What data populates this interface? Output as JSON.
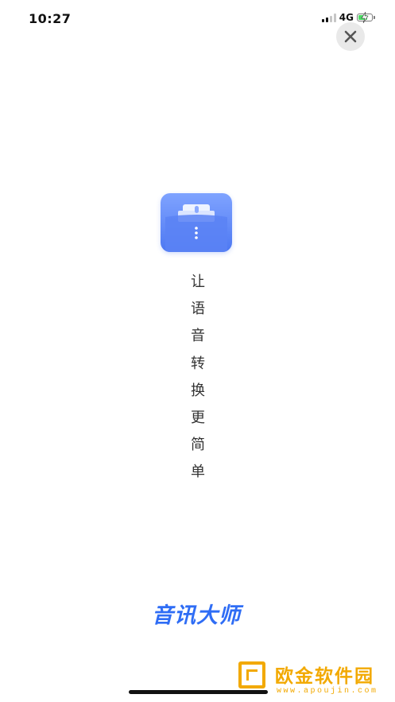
{
  "status_bar": {
    "time": "10:27",
    "network": "4G",
    "signal_bars": 4,
    "signal_active": 2,
    "battery_level": 0.68,
    "battery_color": "#4cd964"
  },
  "close_button": {
    "icon": "close-icon"
  },
  "app_icon": {
    "icon": "folder-mic-icon",
    "colors": [
      "#7fa3ff",
      "#4d78f2"
    ]
  },
  "slogan": {
    "chars": [
      "让",
      "语",
      "音",
      "转",
      "换",
      "更",
      "简",
      "单"
    ]
  },
  "brand": {
    "name": "音讯大师",
    "color": "#2f6df5"
  },
  "watermark": {
    "title": "欧金软件园",
    "url": "www.apoujin.com",
    "color": "#f2a900"
  }
}
